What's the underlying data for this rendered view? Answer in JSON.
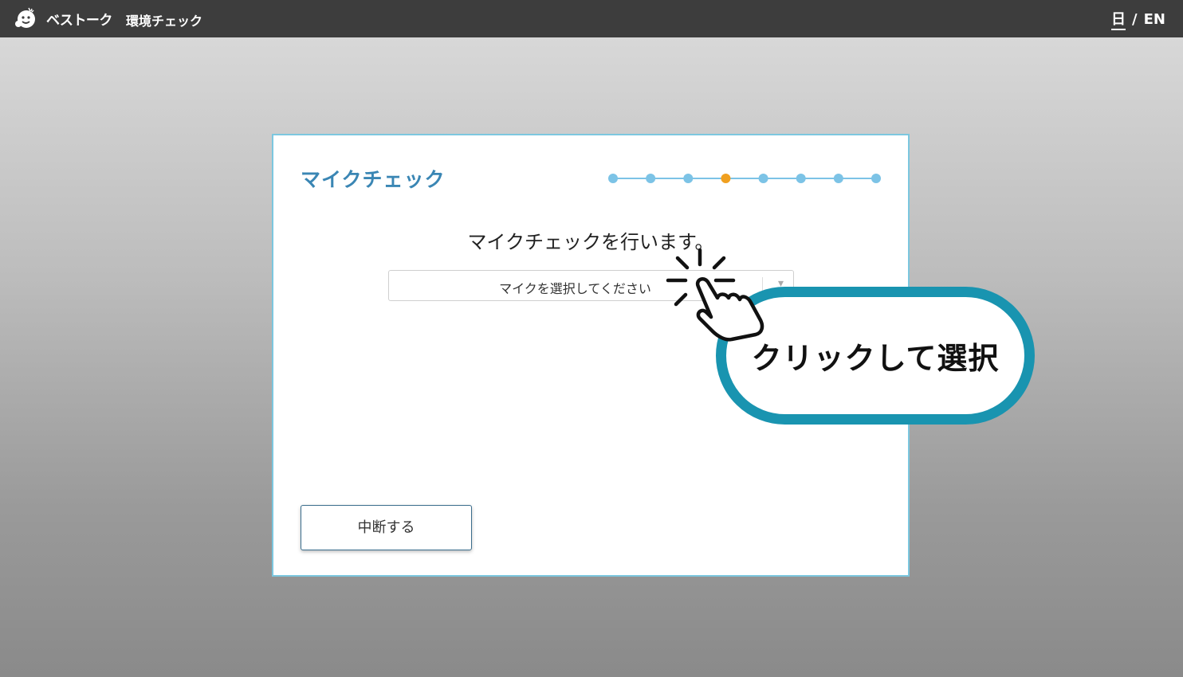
{
  "header": {
    "brand": "ベストーク",
    "subtitle": "環境チェック",
    "lang_ja": "日",
    "lang_sep": "/",
    "lang_en": "EN"
  },
  "card": {
    "title": "マイクチェック",
    "progress": {
      "total_steps": 8,
      "current_step": 4,
      "active_color": "#f0a020",
      "inactive_color": "#7cc3e6"
    },
    "message": "マイクチェックを行います。",
    "select_placeholder": "マイクを選択してください",
    "abort_label": "中断する"
  },
  "callout": {
    "text": "クリックして選択"
  },
  "colors": {
    "accent": "#3a86b4",
    "callout_border": "#1994b0",
    "header_bg": "#3d3d3d"
  }
}
